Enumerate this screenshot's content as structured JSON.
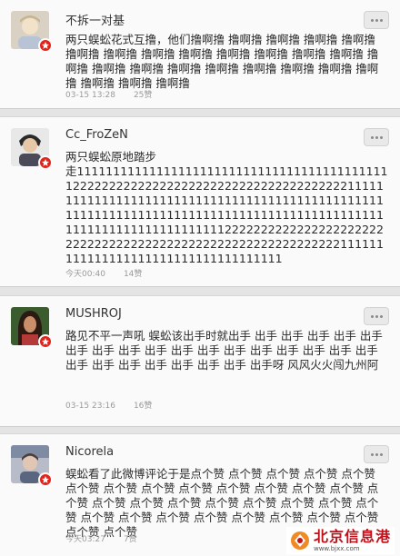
{
  "comments": [
    {
      "username": "不拆一对基",
      "text": "两只蜈蚣花式互撸，他们撸啊撸 撸啊撸 撸啊撸 撸啊撸 撸啊撸 撸啊撸 撸啊撸 撸啊撸 撸啊撸 撸啊撸 撸啊撸 撸啊撸 撸啊撸 撸啊撸 撸啊撸 撸啊撸 撸啊撸 撸啊撸 撸啊撸 撸啊撸 撸啊撸 撸啊撸 撸啊撸 撸啊撸 撸啊撸",
      "time": "03-15 13:28",
      "likes": "25赞"
    },
    {
      "username": "Cc_FroZeN",
      "text": "两只蜈蚣原地踏步\n走11111111111111111111111111111111111111111111222222222222222222222222222222222222221111111111111111111111111111111111111111111111111111111111111111111111111111111111111111111111111111111111111111111222222222222222222222222222222222222222222222222222222222222111111111111111111111111111111111111",
      "time": "今天00:40",
      "likes": "14赞"
    },
    {
      "username": "MUSHROJ",
      "text": "路见不平一声吼 蜈蚣该出手时就出手 出手 出手 出手 出手 出手 出手 出手 出手 出手 出手 出手 出手 出手 出手 出手 出手 出手 出手 出手 出手 出手 出手 出手 出手 出手呀 风风火火闯九州阿",
      "time": "03-15 23:16",
      "likes": "16赞"
    },
    {
      "username": "Nicorela",
      "text": "蜈蚣看了此微博评论于是点个赞 点个赞 点个赞 点个赞 点个赞 点个赞 点个赞 点个赞 点个赞 点个赞 点个赞 点个赞 点个赞 点个赞 点个赞 点个赞 点个赞 点个赞 点个赞 点个赞 点个赞 点个赞 点个赞 点个赞 点个赞 点个赞 点个赞 点个赞 点个赞 点个赞 点个赞 点个赞",
      "time": "今天03:27",
      "likes": "7赞"
    }
  ],
  "icons": {
    "more": "more-options-icon",
    "badge": "verified-badge-icon"
  },
  "colors": {
    "badge": "#e2231a",
    "watermark": "#c0101a",
    "meta": "#9a9a9a"
  },
  "watermark": {
    "title": "北京信息港",
    "url": "www.bjxx.com"
  }
}
